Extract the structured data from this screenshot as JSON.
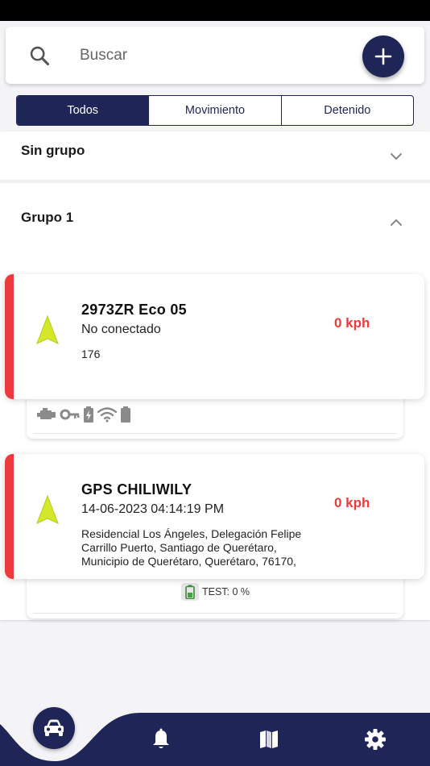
{
  "search": {
    "placeholder": "Buscar"
  },
  "filter_tabs": [
    {
      "label": "Todos",
      "active": true
    },
    {
      "label": "Movimiento",
      "active": false
    },
    {
      "label": "Detenido",
      "active": false
    }
  ],
  "groups": [
    {
      "title": "Sin grupo",
      "expanded": false
    },
    {
      "title": "Grupo 1",
      "expanded": true
    }
  ],
  "vehicles": [
    {
      "name": "2973ZR Eco 05",
      "status": "No conectado",
      "detail": "176",
      "speed": "0 kph",
      "footer_icons": [
        "engine-icon",
        "key-icon",
        "battery-charging-icon",
        "wifi-icon",
        "battery-icon"
      ]
    },
    {
      "name": "GPS CHILIWILY",
      "status": "14-06-2023 04:14:19 PM",
      "detail": "Residencial Los Ángeles, Delegación Felipe Carrillo Puerto, Santiago de Querétaro, Municipio de Querétaro, Querétaro, 76170,",
      "speed": "0 kph",
      "sensor_label": "TEST: 0 %"
    }
  ],
  "bottom_nav": [
    "car-icon",
    "bell-icon",
    "map-icon",
    "gear-icon"
  ],
  "colors": {
    "primary": "#1f2557",
    "accent_red": "#ee3a3a",
    "nav_arrow": "#d4e82a"
  }
}
